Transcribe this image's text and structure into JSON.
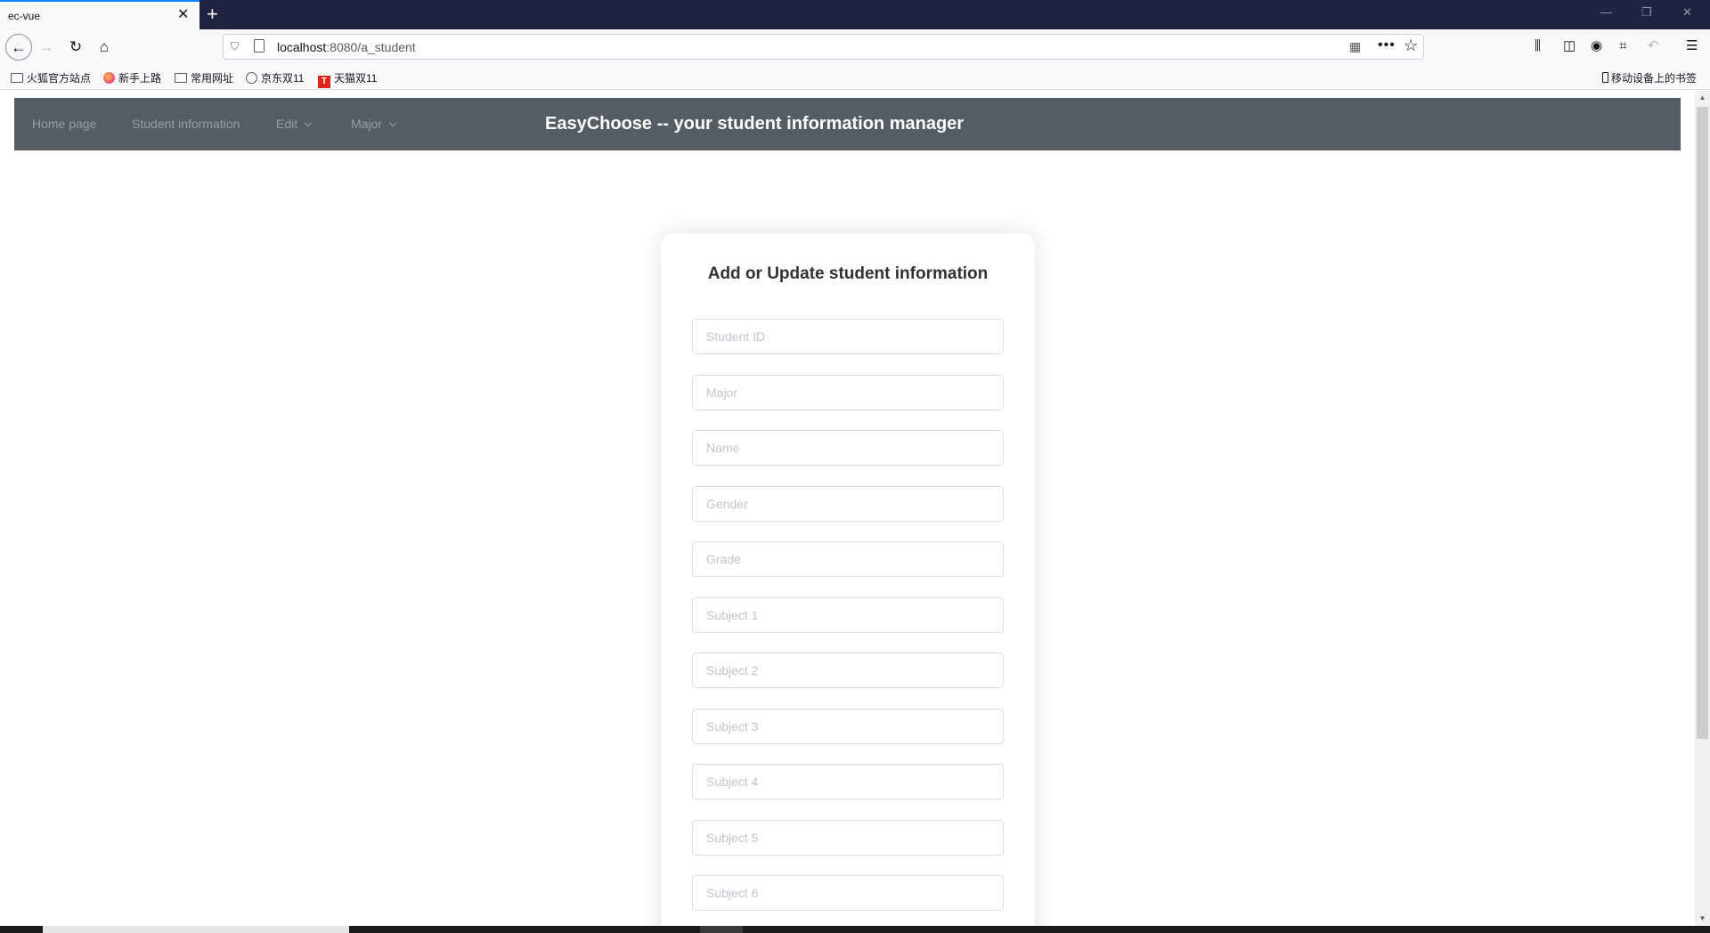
{
  "browser": {
    "tab_title": "ec-vue",
    "tab_close": "✕",
    "new_tab": "+",
    "window_controls": [
      "—",
      "❐",
      "✕"
    ],
    "url_host": "localhost",
    "url_path": ":8080/a_student",
    "accent_color": "#0a84ff"
  },
  "bookmarks": {
    "items": [
      "火狐官方站点",
      "新手上路",
      "常用网址",
      "京东双11",
      "天猫双11"
    ],
    "mobile": "移动设备上的书签",
    "tmall_icon_letter": "T"
  },
  "app": {
    "header_bg": "#545c64",
    "menu": [
      "Home page",
      "Student information",
      "Edit",
      "Major"
    ],
    "title": "EasyChoose -- your student information manager"
  },
  "form": {
    "title": "Add or Update student information",
    "fields": [
      {
        "placeholder": "Student ID",
        "value": ""
      },
      {
        "placeholder": "Major",
        "value": ""
      },
      {
        "placeholder": "Name",
        "value": ""
      },
      {
        "placeholder": "Gender",
        "value": ""
      },
      {
        "placeholder": "Grade",
        "value": ""
      },
      {
        "placeholder": "Subject 1",
        "value": ""
      },
      {
        "placeholder": "Subject 2",
        "value": ""
      },
      {
        "placeholder": "Subject 3",
        "value": ""
      },
      {
        "placeholder": "Subject 4",
        "value": ""
      },
      {
        "placeholder": "Subject 5",
        "value": ""
      },
      {
        "placeholder": "Subject 6",
        "value": ""
      }
    ]
  }
}
